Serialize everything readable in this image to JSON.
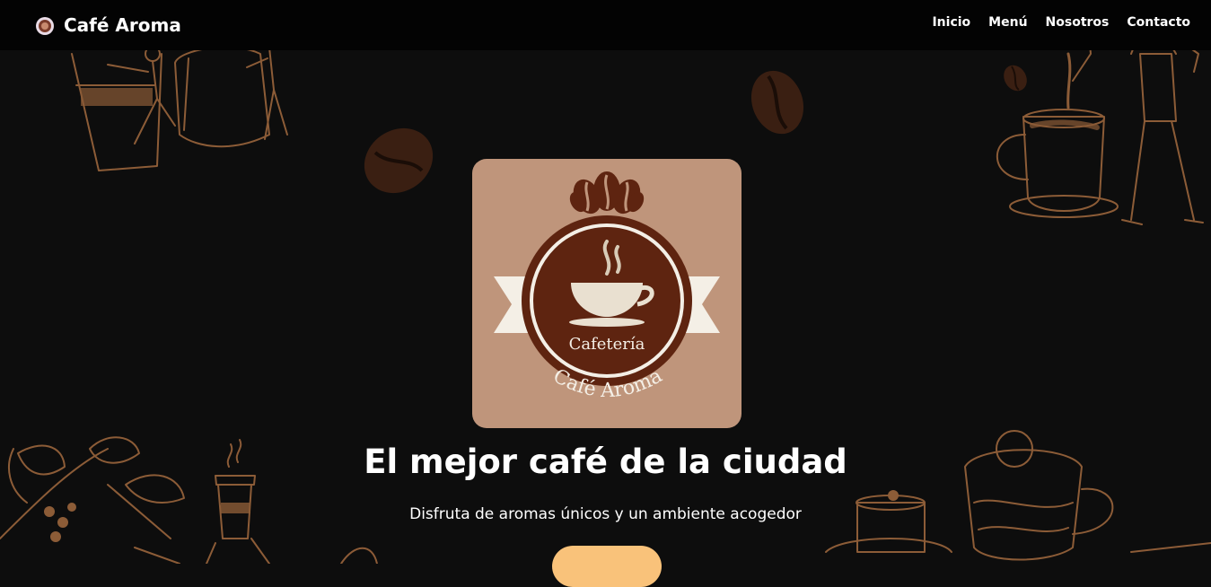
{
  "navbar": {
    "brand_name": "Café Aroma",
    "brand_icon": "coffee-cup-icon",
    "links": [
      "Inicio",
      "Menú",
      "Nosotros",
      "Contacto"
    ]
  },
  "hero": {
    "logo": {
      "top_text": "Cafetería",
      "arc_text": "Café Aroma"
    },
    "title": "El mejor café de la ciudad",
    "subtitle": "Disfruta de aromas únicos y un ambiente acogedor",
    "cta_label": ""
  },
  "colors": {
    "background": "#0d0d0d",
    "navbar": "#030303",
    "sketch_lines": "#a36a3f",
    "logo_card": "#bf957b",
    "logo_brown": "#5e2410",
    "cta": "#f9c27a"
  }
}
